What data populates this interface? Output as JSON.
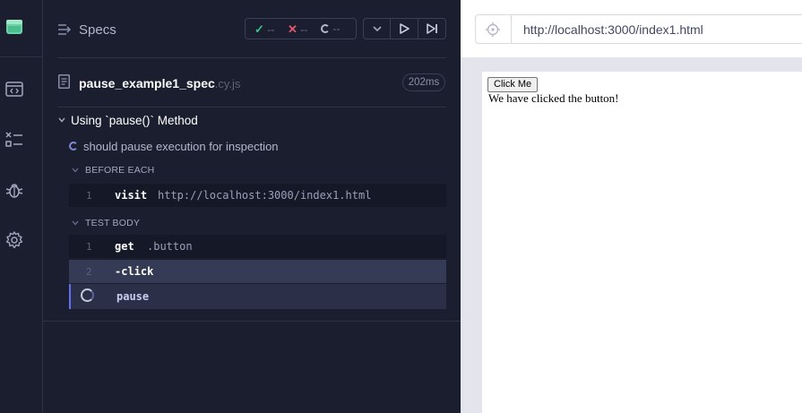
{
  "reporter": {
    "title": "Specs",
    "stats": {
      "passed": "--",
      "failed": "--",
      "pending": "--"
    },
    "file": {
      "name": "pause_example1_spec",
      "ext": ".cy.js",
      "duration": "202ms"
    },
    "suite": {
      "title": "Using `pause()` Method"
    },
    "test": {
      "title": "should pause execution for inspection"
    },
    "hooks": {
      "before_each": {
        "title": "BEFORE EACH",
        "commands": [
          {
            "num": "1",
            "name": "visit",
            "arg": "http://localhost:3000/index1.html"
          }
        ]
      },
      "test_body": {
        "title": "TEST BODY",
        "commands": [
          {
            "num": "1",
            "name": "get",
            "arg": ".button"
          },
          {
            "num": "2",
            "name": "-click",
            "arg": ""
          },
          {
            "num": "",
            "name": "pause",
            "arg": ""
          }
        ]
      }
    }
  },
  "aut": {
    "url": "http://localhost:3000/index1.html",
    "button_label": "Click Me",
    "message": "We have clicked the button!"
  },
  "icons": [
    "cypress-logo-icon",
    "code-icon",
    "specs-list-icon",
    "bug-icon",
    "gear-icon",
    "file-icon",
    "selector-playground-icon",
    "play-icon",
    "next-icon",
    "chevron-down-icon"
  ],
  "colors": {
    "accent": "#6470f3",
    "pass": "#34c38f",
    "fail": "#e45770",
    "logo": "#69d3a7"
  }
}
